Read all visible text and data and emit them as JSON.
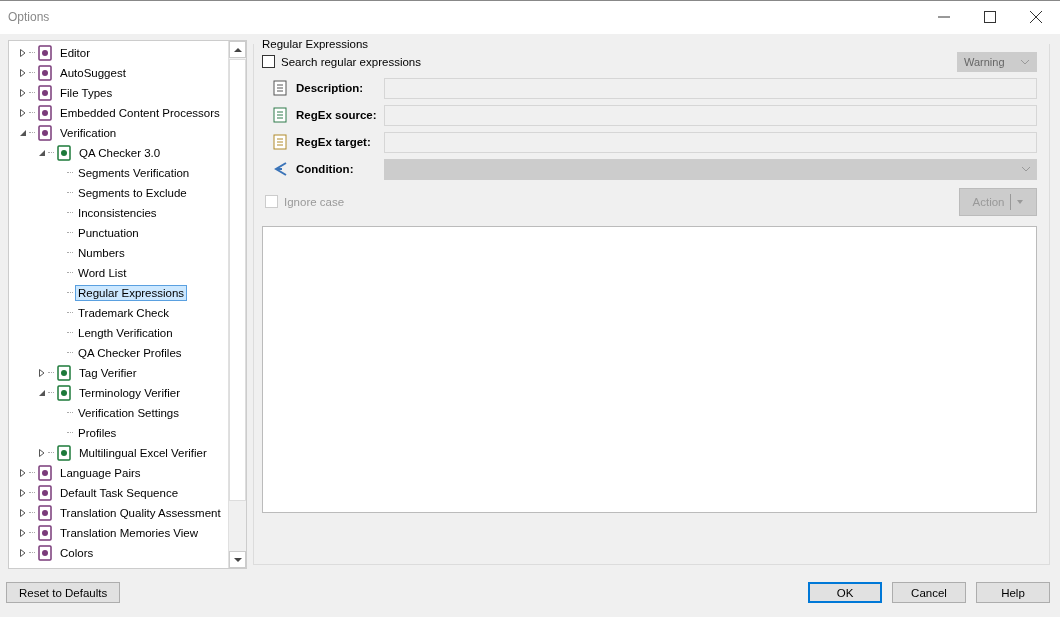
{
  "window": {
    "title": "Options"
  },
  "tree": [
    {
      "label": "Editor",
      "expanded": false,
      "selected": false
    },
    {
      "label": "AutoSuggest",
      "expanded": false,
      "selected": false
    },
    {
      "label": "File Types",
      "expanded": false,
      "selected": false
    },
    {
      "label": "Embedded Content Processors",
      "expanded": false,
      "selected": false
    },
    {
      "label": "Verification",
      "expanded": true,
      "selected": false,
      "children": [
        {
          "label": "QA Checker 3.0",
          "expanded": true,
          "selected": false,
          "children": [
            {
              "label": "Segments Verification",
              "selected": false
            },
            {
              "label": "Segments to Exclude",
              "selected": false
            },
            {
              "label": "Inconsistencies",
              "selected": false
            },
            {
              "label": "Punctuation",
              "selected": false
            },
            {
              "label": "Numbers",
              "selected": false
            },
            {
              "label": "Word List",
              "selected": false
            },
            {
              "label": "Regular Expressions",
              "selected": true
            },
            {
              "label": "Trademark Check",
              "selected": false
            },
            {
              "label": "Length Verification",
              "selected": false
            },
            {
              "label": "QA Checker Profiles",
              "selected": false
            }
          ]
        },
        {
          "label": "Tag Verifier",
          "expanded": false,
          "selected": false
        },
        {
          "label": "Terminology Verifier",
          "expanded": true,
          "selected": false,
          "children": [
            {
              "label": "Verification Settings",
              "selected": false
            },
            {
              "label": "Profiles",
              "selected": false
            }
          ]
        },
        {
          "label": "Multilingual Excel Verifier",
          "expanded": false,
          "selected": false
        }
      ]
    },
    {
      "label": "Language Pairs",
      "expanded": false,
      "selected": false
    },
    {
      "label": "Default Task Sequence",
      "expanded": false,
      "selected": false
    },
    {
      "label": "Translation Quality Assessment",
      "expanded": false,
      "selected": false
    },
    {
      "label": "Translation Memories View",
      "expanded": false,
      "selected": false
    },
    {
      "label": "Colors",
      "expanded": false,
      "selected": false
    }
  ],
  "panel": {
    "title": "Regular Expressions",
    "search_checkbox": {
      "label": "Search regular expressions",
      "checked": false
    },
    "severity": {
      "value": "Warning",
      "disabled": true
    },
    "fields": [
      {
        "label": "Description:",
        "kind": "text"
      },
      {
        "label": "RegEx source:",
        "kind": "text"
      },
      {
        "label": "RegEx target:",
        "kind": "text"
      },
      {
        "label": "Condition:",
        "kind": "dropdown"
      }
    ],
    "ignore_case": {
      "label": "Ignore case",
      "checked": false,
      "disabled": true
    },
    "action_button": {
      "label": "Action",
      "disabled": true
    }
  },
  "buttons": [
    {
      "label": "Reset to Defaults",
      "kind": "left",
      "default": false
    },
    {
      "label": "OK",
      "kind": "right",
      "default": true
    },
    {
      "label": "Cancel",
      "kind": "right",
      "default": false
    },
    {
      "label": "Help",
      "kind": "right",
      "default": false
    }
  ]
}
